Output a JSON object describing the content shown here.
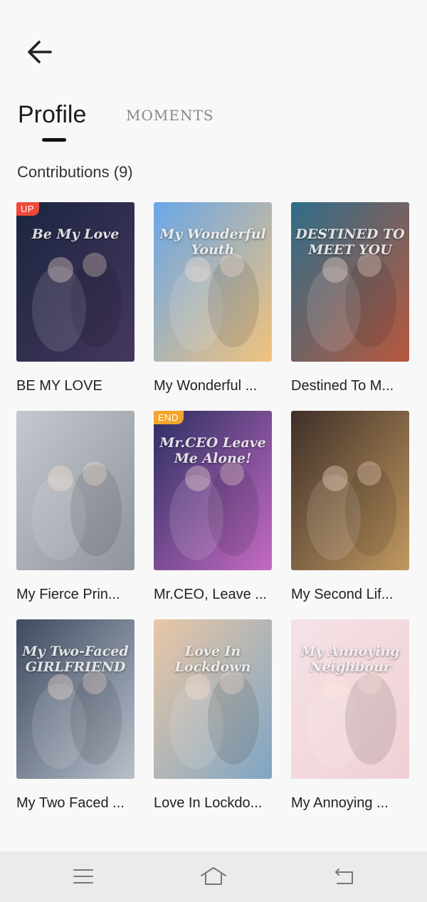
{
  "header": {
    "back_icon": "arrow-left-icon"
  },
  "tabs": [
    {
      "label": "Profile",
      "active": true
    },
    {
      "label": "MOMENTS",
      "active": false
    }
  ],
  "contributions": {
    "heading": "Contributions (9)",
    "items": [
      {
        "title": "BE MY LOVE",
        "badge": "UP",
        "badge_color": "#ef4a3c",
        "cover_colors": [
          "#1b2540",
          "#46375e"
        ],
        "cover_text": "Be My Love"
      },
      {
        "title": "My Wonderful ...",
        "badge": "",
        "badge_color": "",
        "cover_colors": [
          "#6aa7e8",
          "#f2c27c"
        ],
        "cover_text": "My Wonderful Youth"
      },
      {
        "title": "Destined To M...",
        "badge": "",
        "badge_color": "",
        "cover_colors": [
          "#2f6d89",
          "#b8583d"
        ],
        "cover_text": "DESTINED TO MEET YOU"
      },
      {
        "title": "My Fierce Prin...",
        "badge": "",
        "badge_color": "",
        "cover_colors": [
          "#c4c8cf",
          "#8f949b"
        ],
        "cover_text": ""
      },
      {
        "title": "Mr.CEO, Leave ...",
        "badge": "END",
        "badge_color": "#f4a52e",
        "cover_colors": [
          "#2b2f63",
          "#c66bc2"
        ],
        "cover_text": "Mr.CEO Leave Me Alone!"
      },
      {
        "title": "My Second Lif...",
        "badge": "",
        "badge_color": "",
        "cover_colors": [
          "#3e2f28",
          "#c19860"
        ],
        "cover_text": ""
      },
      {
        "title": "My Two Faced ...",
        "badge": "",
        "badge_color": "",
        "cover_colors": [
          "#3e4a5f",
          "#b8c0cc"
        ],
        "cover_text": "My Two-Faced GIRLFRIEND"
      },
      {
        "title": "Love In Lockdo...",
        "badge": "",
        "badge_color": "",
        "cover_colors": [
          "#e9c7a6",
          "#7fa5c4"
        ],
        "cover_text": "Love In Lockdown"
      },
      {
        "title": "My Annoying ...",
        "badge": "",
        "badge_color": "",
        "cover_colors": [
          "#f5e3e7",
          "#f0cfd4"
        ],
        "cover_text": "My Annoying Neighbour"
      }
    ]
  },
  "navbar": {
    "menu_icon": "menu-icon",
    "home_icon": "home-icon",
    "back_icon": "back-nav-icon"
  }
}
